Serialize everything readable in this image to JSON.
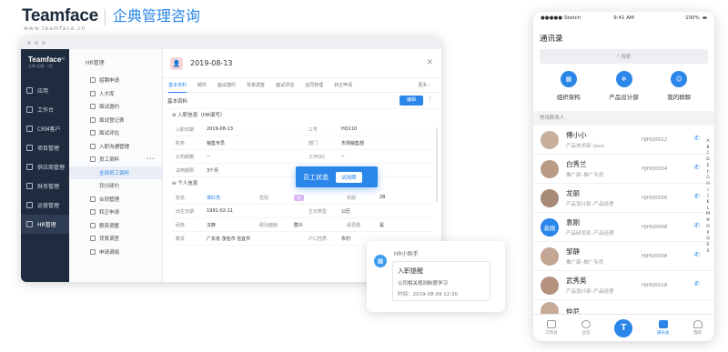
{
  "brand": {
    "logo": "Teamface",
    "url": "www.teamface.cn",
    "slogan": "企典管理咨询"
  },
  "desktop": {
    "sidebar": {
      "logo": "Teamface",
      "sub": "企典·企服·一切",
      "items": [
        {
          "label": "应用"
        },
        {
          "label": "工作台"
        },
        {
          "label": "CRM客户"
        },
        {
          "label": "项目管理"
        },
        {
          "label": "供应商管理"
        },
        {
          "label": "财务管理"
        },
        {
          "label": "运营管理"
        },
        {
          "label": "HR管理"
        }
      ]
    },
    "nav": {
      "title": "HR管理",
      "items": [
        {
          "label": "招聘申请"
        },
        {
          "label": "人才库"
        },
        {
          "label": "面试邀约"
        },
        {
          "label": "面试登记表"
        },
        {
          "label": "面试评估"
        },
        {
          "label": "入职沟通管理"
        },
        {
          "label": "员工资料"
        },
        {
          "label": "全部员工资料"
        },
        {
          "label": "我创建的"
        },
        {
          "label": "合同管理"
        },
        {
          "label": "转正申请"
        },
        {
          "label": "薪资调整"
        },
        {
          "label": "背景调查"
        },
        {
          "label": "申请调组"
        }
      ]
    },
    "detail": {
      "date": "2019-08-13",
      "tabs": [
        "基本资料",
        "邮件",
        "面试邀约",
        "背景调查",
        "面试评估",
        "合同管理",
        "转正申请"
      ],
      "tab_more": "更多",
      "section": "基本资料",
      "edit": "编辑",
      "group1": "入职信息（HR填写）",
      "group2": "个人信息",
      "rows": {
        "entry_date_label": "入职日期",
        "entry_date": "2019-08-13",
        "emp_no_label": "工号",
        "emp_no": "HQ110",
        "position_label": "职务",
        "position": "销售专员",
        "dept_label": "部门",
        "dept": "市场销售部",
        "email_label": "公司邮箱",
        "email": "--",
        "qq_label": "工作QQ",
        "qq": "--",
        "probation_label": "试用期限",
        "probation": "3个月",
        "name_label": "姓名",
        "name": "谭红亮",
        "gender_label": "性别",
        "gender": "女",
        "age_label": "年龄",
        "age": "28",
        "birth_label": "出生日期",
        "birth": "1991-02-11",
        "zodiac_label": "生日类型",
        "zodiac": "公历",
        "ethnic_label": "民族",
        "ethnic": "汉族",
        "political_label": "政治面貌",
        "political": "群众",
        "marital_label": "是否婚",
        "marital": "是",
        "native_label": "籍贯",
        "native": "广东省 茂名市 信宜市",
        "hukou_label": "户口性质",
        "hukou": "农村"
      }
    },
    "popup": {
      "label": "员工状态",
      "button": "试用期"
    }
  },
  "notification": {
    "title": "HR小助手",
    "heading": "入职提醒",
    "line": "公司相关规则制度学习",
    "time": "时间：2019-08-09 12:30"
  },
  "phone": {
    "status": {
      "carrier": "●●●●● Sketch",
      "time": "9:41 AM",
      "battery": "100%"
    },
    "title": "通讯录",
    "search": "搜索",
    "quick": [
      {
        "label": "组织架构"
      },
      {
        "label": "产品设计部"
      },
      {
        "label": "我的群聊"
      }
    ],
    "section": "常用联系人",
    "contacts": [
      {
        "name": "傅小小",
        "sub": "产品技术部–Java",
        "code": "HJHQ0012"
      },
      {
        "name": "白秀兰",
        "sub": "推广部–推广专员",
        "code": "HJHQ0034"
      },
      {
        "name": "龙丽",
        "sub": "产品设计部–产品经理",
        "code": "HJHQ0056"
      },
      {
        "name": "袁刚",
        "sub": "产品研发部–产品经理",
        "code": "HJHQ0068",
        "avatar": "袁刚"
      },
      {
        "name": "邹静",
        "sub": "推广部–推广专员",
        "code": "HJHQ0008"
      },
      {
        "name": "武秀英",
        "sub": "产品设计部–产品经理",
        "code": "HJHQ0018"
      },
      {
        "name": "仲尼",
        "sub": "",
        "code": ""
      }
    ],
    "alphabet": "ABCDEFGHIJKLMNOPQRS",
    "tabs": [
      {
        "label": "工作台"
      },
      {
        "label": "企信"
      },
      {
        "label": "T"
      },
      {
        "label": "通讯录"
      },
      {
        "label": "我的"
      }
    ]
  }
}
